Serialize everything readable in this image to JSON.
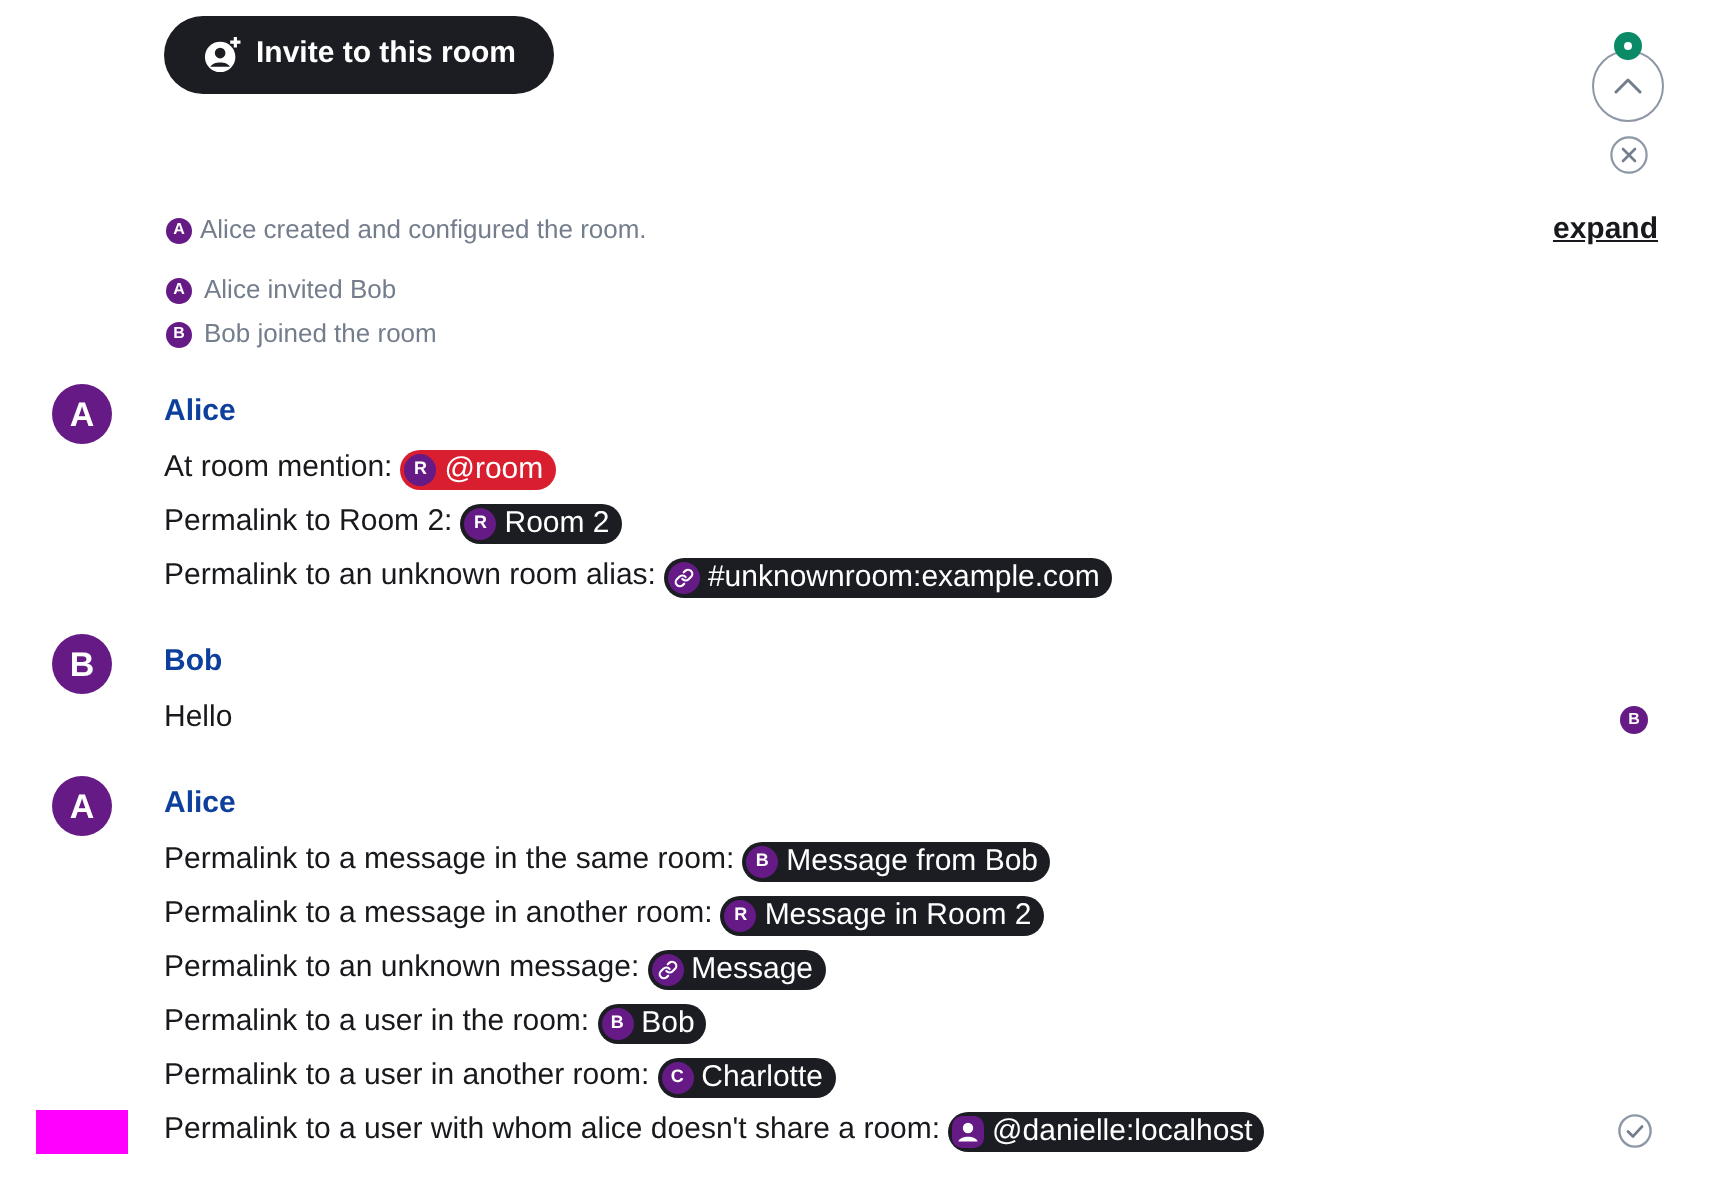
{
  "invite_button": {
    "label": "Invite to this room"
  },
  "jump_controls": {
    "unread": true
  },
  "event_summary": {
    "avatar": "A",
    "text": "Alice created and configured the room.",
    "toggle": "expand"
  },
  "membership_events": [
    {
      "avatar": "A",
      "text": "Alice invited Bob"
    },
    {
      "avatar": "B",
      "text": "Bob joined the room"
    }
  ],
  "message_groups": [
    {
      "avatar": "A",
      "sender": "Alice",
      "messages": [
        {
          "text": "At room mention:",
          "pill": {
            "kind": "at-room",
            "avatar": "R",
            "label": "@room"
          }
        },
        {
          "text": "Permalink to Room 2:",
          "pill": {
            "kind": "room",
            "avatar": "R",
            "label": "Room 2"
          }
        },
        {
          "text": "Permalink to an unknown room alias:",
          "pill": {
            "kind": "alias",
            "label": "#unknownroom:example.com"
          }
        }
      ]
    },
    {
      "avatar": "B",
      "sender": "Bob",
      "messages": [
        {
          "text": "Hello",
          "read_receipts": [
            "B"
          ]
        }
      ]
    },
    {
      "avatar": "A",
      "sender": "Alice",
      "messages": [
        {
          "text": "Permalink to a message in the same room:",
          "pill": {
            "kind": "message",
            "avatar": "B",
            "label": "Message from Bob"
          }
        },
        {
          "text": "Permalink to a message in another room:",
          "pill": {
            "kind": "message",
            "avatar": "R",
            "label": "Message in Room 2"
          }
        },
        {
          "text": "Permalink to an unknown message:",
          "pill": {
            "kind": "unknown-message",
            "label": "Message"
          }
        },
        {
          "text": "Permalink to a user in the room:",
          "pill": {
            "kind": "user",
            "avatar": "B",
            "label": "Bob"
          }
        },
        {
          "text": "Permalink to a user in another room:",
          "pill": {
            "kind": "user",
            "avatar": "C",
            "label": "Charlotte"
          }
        },
        {
          "text": "Permalink to a user with whom alice doesn't share a room:",
          "pill": {
            "kind": "unknown-user",
            "label": "@danielle:localhost"
          },
          "sent": true,
          "timestamp_masked": true
        }
      ]
    }
  ]
}
